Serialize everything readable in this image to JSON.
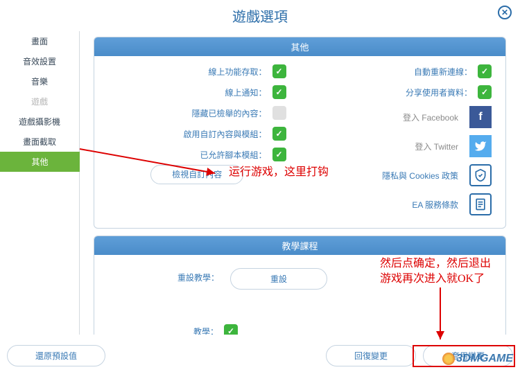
{
  "header": {
    "title": "遊戲選項"
  },
  "sidebar": {
    "items": [
      {
        "label": "畫面"
      },
      {
        "label": "音效設置"
      },
      {
        "label": "音樂"
      },
      {
        "label": "遊戲"
      },
      {
        "label": "遊戲攝影機"
      },
      {
        "label": "畫面截取"
      },
      {
        "label": "其他"
      }
    ]
  },
  "panel_other": {
    "title": "其他",
    "left": {
      "online_storage": "線上功能存取：",
      "online_notify": "線上通知：",
      "hide_content": "隱藏已檢舉的內容：",
      "enable_custom": "啟用自訂內容與模組：",
      "allow_script": "已允許腳本模組：",
      "browse_btn": "檢視自訂內容"
    },
    "right": {
      "auto_reconnect": "自動重新連線：",
      "share_data": "分享使用者資料：",
      "login_fb": "登入 Facebook",
      "login_tw": "登入 Twitter",
      "privacy": "隱私與 Cookies 政策",
      "ea_tos": "EA 服務條款"
    }
  },
  "panel_tutorial": {
    "title": "教學課程",
    "reset_label": "重設教學：",
    "reset_btn": "重設",
    "tutorial_label": "教學："
  },
  "bottom": {
    "restore": "還原預設值",
    "revert": "回復變更",
    "apply": "套用變更"
  },
  "annotations": {
    "note1": "运行游戏，这里打钩",
    "note2_line1": "然后点确定，然后退出",
    "note2_line2": "游戏再次进入就OK了"
  },
  "watermark": "3DMGAME"
}
